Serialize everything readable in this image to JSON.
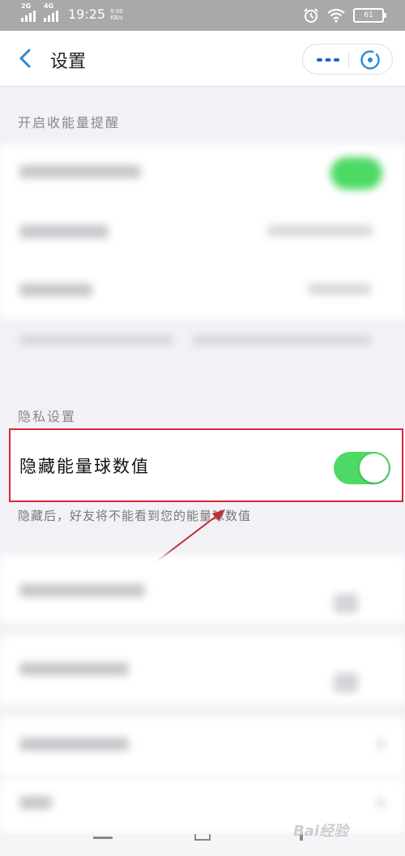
{
  "status_bar": {
    "sim1_label": "2G",
    "sim2_label": "4G",
    "time": "19:25",
    "speed_value": "0.00",
    "speed_unit": "KB/s",
    "battery": "61",
    "icons": [
      "alarm-icon",
      "wifi-icon",
      "battery-icon"
    ]
  },
  "nav": {
    "title": "设置",
    "back_icon": "chevron-left-icon",
    "more_icon": "more-dots-icon",
    "close_icon": "close-miniapp-icon",
    "accent_color": "#2a8ad8"
  },
  "sections": {
    "energy_reminder": {
      "header": "开启收能量提醒"
    },
    "privacy": {
      "header": "隐私设置",
      "hide_energy_ball": {
        "label": "隐藏能量球数值",
        "enabled": true,
        "hint": "隐藏后，好友将不能看到您的能量球数值"
      }
    }
  },
  "annotation": {
    "highlight_color": "#d42a3a"
  },
  "toggle_color": "#4cd964",
  "watermark": "Bai经验"
}
